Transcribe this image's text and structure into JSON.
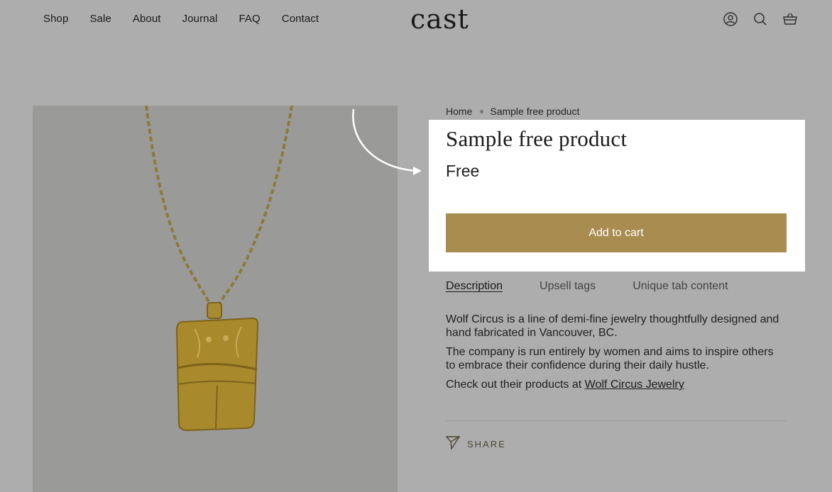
{
  "nav": {
    "items": [
      "Shop",
      "Sale",
      "About",
      "Journal",
      "FAQ",
      "Contact"
    ]
  },
  "brand": {
    "logo_text": "cast"
  },
  "header_icons": [
    "account-icon",
    "search-icon",
    "cart-icon"
  ],
  "breadcrumb": {
    "home": "Home",
    "current": "Sample free product"
  },
  "product": {
    "title": "Sample free product",
    "price": "Free",
    "add_to_cart_label": "Add to cart"
  },
  "tabs": [
    {
      "label": "Description",
      "active": true
    },
    {
      "label": "Upsell tags",
      "active": false
    },
    {
      "label": "Unique tab content",
      "active": false
    }
  ],
  "description": {
    "p1": "Wolf Circus is a line of demi-fine jewelry thoughtfully designed and hand fabricated in Vancouver, BC.",
    "p2": "The company is run entirely by women and aims to inspire others to embrace their confidence during their daily hustle.",
    "p3_prefix": "Check out their products at ",
    "p3_link": "Wolf Circus Jewelry"
  },
  "share": {
    "label": "SHARE"
  },
  "colors": {
    "accent": "#a98c50",
    "overlay_bg": "#adadad",
    "panel": "#ffffff"
  }
}
